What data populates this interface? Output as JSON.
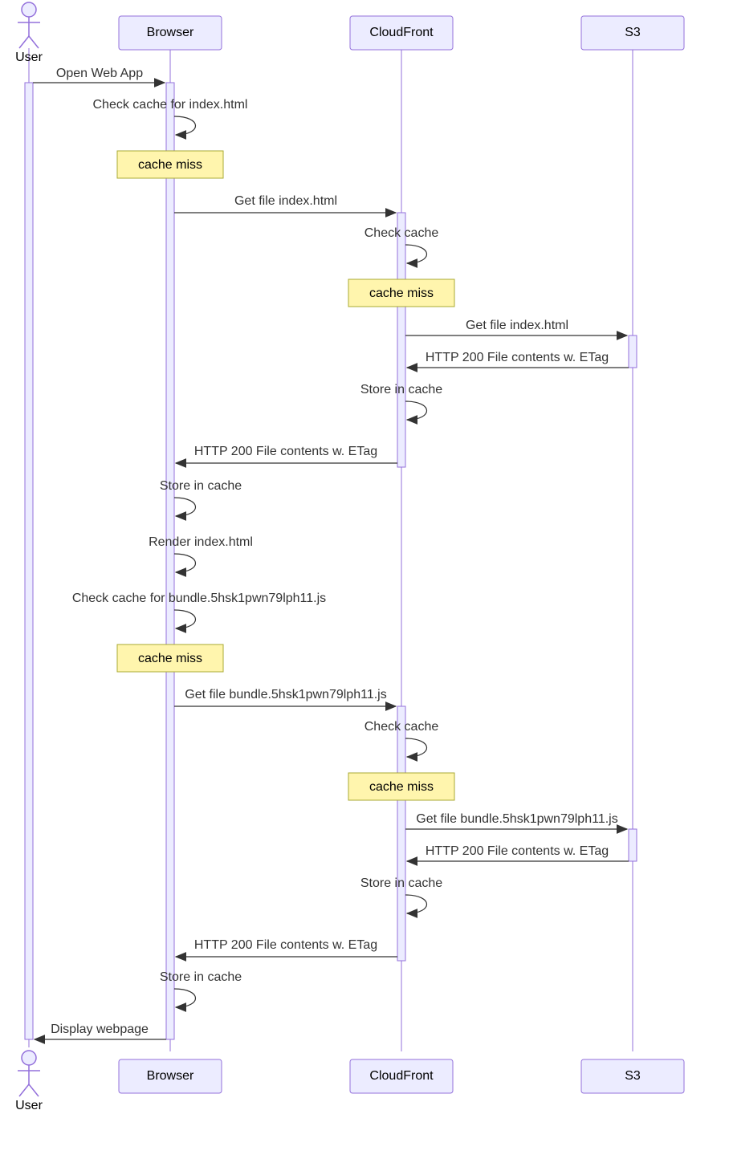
{
  "chart_data": {
    "type": "sequence-diagram",
    "participants": [
      {
        "id": "user",
        "label": "User",
        "kind": "actor"
      },
      {
        "id": "browser",
        "label": "Browser",
        "kind": "participant"
      },
      {
        "id": "cloudfront",
        "label": "CloudFront",
        "kind": "participant"
      },
      {
        "id": "s3",
        "label": "S3",
        "kind": "participant"
      }
    ],
    "messages": [
      {
        "from": "user",
        "to": "browser",
        "text": "Open Web App"
      },
      {
        "from": "browser",
        "to": "browser",
        "text": "Check cache for index.html"
      },
      {
        "note_over": "browser",
        "text": "cache miss"
      },
      {
        "from": "browser",
        "to": "cloudfront",
        "text": "Get file index.html"
      },
      {
        "from": "cloudfront",
        "to": "cloudfront",
        "text": "Check cache"
      },
      {
        "note_over": "cloudfront",
        "text": "cache miss"
      },
      {
        "from": "cloudfront",
        "to": "s3",
        "text": "Get file index.html"
      },
      {
        "from": "s3",
        "to": "cloudfront",
        "text": "HTTP 200 File contents w. ETag"
      },
      {
        "from": "cloudfront",
        "to": "cloudfront",
        "text": "Store in cache"
      },
      {
        "from": "cloudfront",
        "to": "browser",
        "text": "HTTP 200 File contents w. ETag"
      },
      {
        "from": "browser",
        "to": "browser",
        "text": "Store in cache"
      },
      {
        "from": "browser",
        "to": "browser",
        "text": "Render index.html"
      },
      {
        "from": "browser",
        "to": "browser",
        "text": "Check cache for bundle.5hsk1pwn79lph11.js"
      },
      {
        "note_over": "browser",
        "text": "cache miss"
      },
      {
        "from": "browser",
        "to": "cloudfront",
        "text": "Get file bundle.5hsk1pwn79lph11.js"
      },
      {
        "from": "cloudfront",
        "to": "cloudfront",
        "text": "Check cache"
      },
      {
        "note_over": "cloudfront",
        "text": "cache miss"
      },
      {
        "from": "cloudfront",
        "to": "s3",
        "text": "Get file bundle.5hsk1pwn79lph11.js"
      },
      {
        "from": "s3",
        "to": "cloudfront",
        "text": "HTTP 200 File contents w. ETag"
      },
      {
        "from": "cloudfront",
        "to": "cloudfront",
        "text": "Store in cache"
      },
      {
        "from": "cloudfront",
        "to": "browser",
        "text": "HTTP 200 File contents w. ETag"
      },
      {
        "from": "browser",
        "to": "browser",
        "text": "Store in cache"
      },
      {
        "from": "browser",
        "to": "user",
        "text": "Display webpage"
      }
    ]
  },
  "colors": {
    "participant_fill": "#ECECFF",
    "participant_stroke": "#9370DB",
    "note_fill": "#fff5ad",
    "note_stroke": "#aaaa33",
    "line": "#333333"
  },
  "labels": {
    "user": "User",
    "browser": "Browser",
    "cloudfront": "CloudFront",
    "s3": "S3",
    "m0": "Open Web App",
    "m1": "Check cache for index.html",
    "n0": "cache miss",
    "m2": "Get file index.html",
    "m3": "Check cache",
    "n1": "cache miss",
    "m4": "Get file index.html",
    "m5": "HTTP 200 File contents w. ETag",
    "m6": "Store in cache",
    "m7": "HTTP 200 File contents w. ETag",
    "m8": "Store in cache",
    "m9": "Render index.html",
    "m10": "Check cache for bundle.5hsk1pwn79lph11.js",
    "n2": "cache miss",
    "m11": "Get file bundle.5hsk1pwn79lph11.js",
    "m12": "Check cache",
    "n3": "cache miss",
    "m13": "Get file bundle.5hsk1pwn79lph11.js",
    "m14": "HTTP 200 File contents w. ETag",
    "m15": "Store in cache",
    "m16": "HTTP 200 File contents w. ETag",
    "m17": "Store in cache",
    "m18": "Display webpage"
  }
}
